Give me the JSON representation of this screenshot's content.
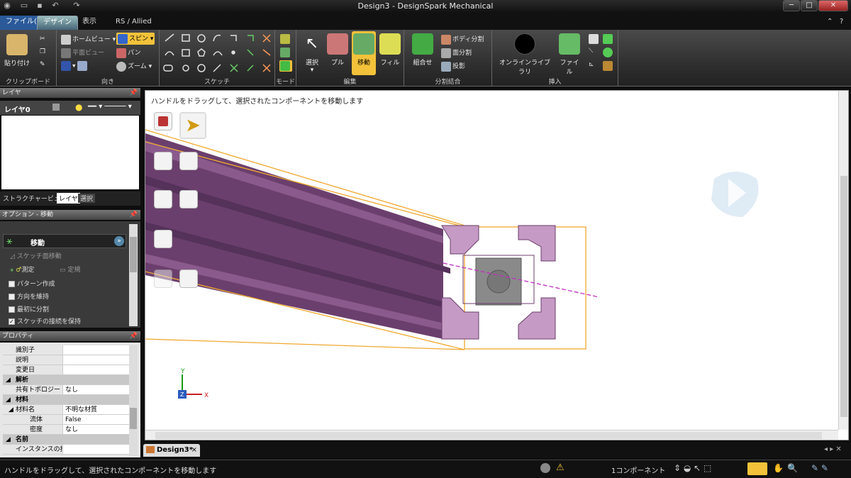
{
  "window": {
    "title": "Design3 - DesignSpark Mechanical",
    "btn_min": "─",
    "btn_max": "□",
    "btn_close": "✕"
  },
  "tabs": [
    {
      "label": "ファイル(F)"
    },
    {
      "label": "デザイン"
    },
    {
      "label": "表示"
    },
    {
      "label": "RS / Allied"
    }
  ],
  "ribbon": {
    "clipboard": {
      "label": "クリップボード",
      "paste": "貼り付け"
    },
    "orient": {
      "label": "向き",
      "home": "ホームビュー",
      "plane": "平面ビュー",
      "spin": "スピン",
      "pan": "パン",
      "zoom": "ズーム"
    },
    "sketch": {
      "label": "スケッチ"
    },
    "mode": {
      "label": "モード"
    },
    "edit": {
      "label": "編集",
      "select": "選択",
      "pull": "プル",
      "move": "移動",
      "fill": "フィル"
    },
    "intersect": {
      "label": "分割結合",
      "combine": "組合せ",
      "split_body": "ボディ分割",
      "split_face": "面分割",
      "project": "投影"
    },
    "insert": {
      "label": "挿入",
      "online": "オンラインライブラリ",
      "file": "ファイル"
    }
  },
  "layers": {
    "header": "レイヤ",
    "layer_name": "レイヤ0"
  },
  "panel_tabs": [
    {
      "label": "ストラクチャービュー"
    },
    {
      "label": "レイヤ"
    },
    {
      "label": "選択"
    }
  ],
  "options": {
    "header": "オプション - 移動",
    "title": "移動",
    "sketch_plane": "スケッチ面移動",
    "measure": "測定",
    "dimension": "定規",
    "checks": [
      {
        "label": "パターン作成",
        "checked": ""
      },
      {
        "label": "方向を維持",
        "checked": ""
      },
      {
        "label": "最初に分割",
        "checked": ""
      },
      {
        "label": "スケッチの接続を保持",
        "checked": "✓"
      }
    ]
  },
  "properties": {
    "header": "プロパティ",
    "rows": [
      {
        "k": "識別子",
        "v": "",
        "cat": false
      },
      {
        "k": "説明",
        "v": "",
        "cat": false
      },
      {
        "k": "変更日",
        "v": "",
        "cat": false
      },
      {
        "k": "解析",
        "v": "",
        "cat": true
      },
      {
        "k": "共有トポロジー",
        "v": "なし",
        "cat": false
      },
      {
        "k": "材料",
        "v": "",
        "cat": true
      },
      {
        "k": "材料名",
        "v": "不明な材質",
        "cat": false
      },
      {
        "k": "流体",
        "v": "False",
        "cat": false
      },
      {
        "k": "密度",
        "v": "なし",
        "cat": false
      },
      {
        "k": "名前",
        "v": "",
        "cat": true
      },
      {
        "k": "インスタンスの挿顕",
        "v": "",
        "cat": false
      }
    ]
  },
  "viewport": {
    "hint": "ハンドルをドラッグして、選択されたコンポーネントを移動します",
    "axis_y": "Y",
    "axis_x": "X",
    "axis_z": "Z"
  },
  "doc_tab": {
    "label": "Design3*",
    "close": "×"
  },
  "status": {
    "text": "ハンドルをドラッグして、選択されたコンポーネントを移動します",
    "count": "1コンポーネント"
  },
  "colors": {
    "profile": "#7d4d7f",
    "highlight": "#c59ac4",
    "bbox": "#f0a830",
    "accent": "#f3c23a"
  }
}
